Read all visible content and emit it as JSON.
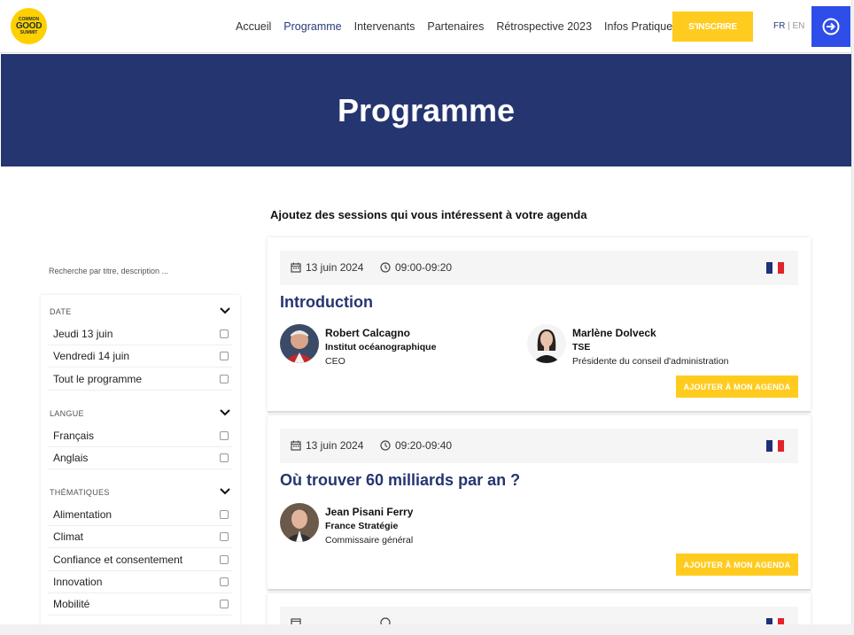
{
  "logo": {
    "line1": "COMMON",
    "line2": "GOOD",
    "line3": "SUMMIT"
  },
  "nav": {
    "items": [
      "Accueil",
      "Programme",
      "Intervenants",
      "Partenaires",
      "Rétrospective 2023",
      "Infos Pratiques"
    ],
    "active": "Programme",
    "signup_label": "S'INSCRIRE",
    "lang_fr": "FR",
    "lang_sep": " | ",
    "lang_en": "EN"
  },
  "banner": {
    "title": "Programme"
  },
  "main": {
    "intro": "Ajoutez des sessions qui vous intéressent à votre agenda"
  },
  "filters": {
    "search_placeholder": "Recherche par titre, description ...",
    "groups": [
      {
        "title": "DATE",
        "items": [
          "Jeudi 13 juin",
          "Vendredi 14 juin",
          "Tout le programme"
        ]
      },
      {
        "title": "LANGUE",
        "items": [
          "Français",
          "Anglais"
        ]
      },
      {
        "title": "THÉMATIQUES",
        "items": [
          "Alimentation",
          "Climat",
          "Confiance et consentement",
          "Innovation",
          "Mobilité"
        ]
      }
    ]
  },
  "sessions": [
    {
      "date": "13 juin 2024",
      "time": "09:00-09:20",
      "title": "Introduction",
      "add_label": "AJOUTER À MON AGENDA",
      "speakers": [
        {
          "name": "Robert Calcagno",
          "org": "Institut océanographique",
          "role": "CEO"
        },
        {
          "name": "Marlène Dolveck",
          "org": "TSE",
          "role": "Présidente du conseil d'administration"
        }
      ]
    },
    {
      "date": "13 juin 2024",
      "time": "09:20-09:40",
      "title": "Où trouver 60 milliards par an ?",
      "add_label": "AJOUTER À MON AGENDA",
      "speakers": [
        {
          "name": "Jean Pisani Ferry",
          "org": "France Stratégie",
          "role": "Commissaire général"
        }
      ]
    }
  ],
  "colors": {
    "navy": "#253570",
    "yellow": "#ffcb1f",
    "blue_button": "#2f4de8"
  }
}
